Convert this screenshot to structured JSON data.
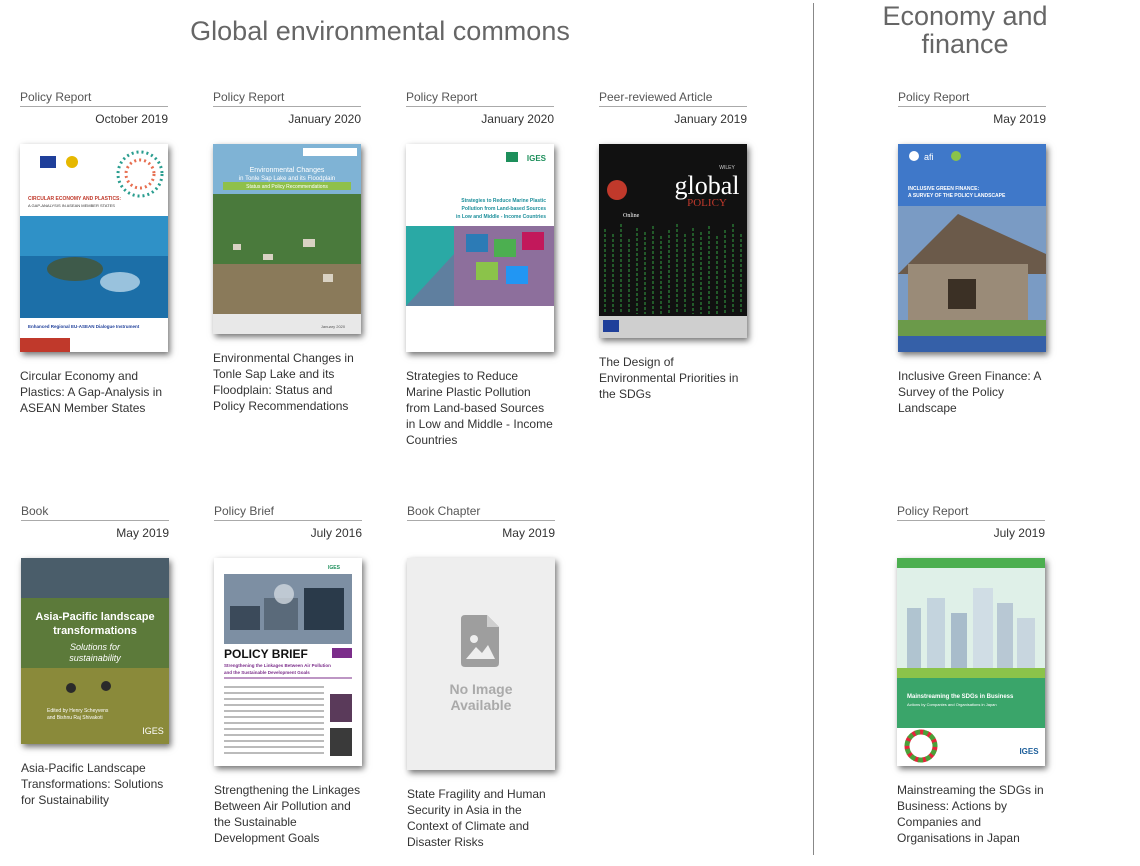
{
  "sections": {
    "global": {
      "title": "Global environmental commons"
    },
    "economy": {
      "title": "Economy and finance"
    }
  },
  "cards": [
    {
      "type": "Policy Report",
      "date": "October 2019",
      "title": "Circular Economy and Plastics: A Gap-Analysis in ASEAN Member States",
      "cover_texts": [
        "CIRCULAR ECONOMY AND PLASTICS:",
        "A GAP-ANALYSIS IN ASEAN MEMBER STATES",
        "Enhanced Regional EU-ASEAN Dialogue Instrument"
      ]
    },
    {
      "type": "Policy Report",
      "date": "January 2020",
      "title": "Environmental Changes in Tonle Sap Lake and its Floodplain: Status and Policy Recommendations",
      "cover_texts": [
        "Environmental Changes",
        "in Tonle Sap Lake and its Floodplain",
        "Status and Policy Recommendations",
        "January 2020"
      ]
    },
    {
      "type": "Policy Report",
      "date": "January 2020",
      "title": "Strategies to Reduce Marine Plastic Pollution from Land-based Sources in Low and Middle - Income Countries",
      "cover_texts": [
        "IGES",
        "Strategies to Reduce Marine Plastic",
        "Pollution from Land-based Sources",
        "in Low and Middle - Income Countries"
      ]
    },
    {
      "type": "Peer-reviewed Article",
      "date": "January 2019",
      "title": "The Design of Environmental Priorities in the SDGs",
      "cover_texts": [
        "global",
        "POLICY",
        "Online",
        "WILEY"
      ]
    },
    {
      "type": "Policy Report",
      "date": "May 2019",
      "title": "Inclusive Green Finance: A Survey of the Policy Landscape",
      "cover_texts": [
        "afi",
        "INCLUSIVE GREEN FINANCE:",
        "A SURVEY OF THE POLICY LANDSCAPE"
      ]
    },
    {
      "type": "Book",
      "date": "May 2019",
      "title": "Asia-Pacific Landscape Transformations: Solutions for Sustainability",
      "cover_texts": [
        "Asia-Pacific landscape",
        "transformations",
        "Solutions for",
        "sustainability",
        "Edited by Henry Scheyvens",
        "and Bishnu Raj Shivakoti",
        "IGES"
      ]
    },
    {
      "type": "Policy Brief",
      "date": "July 2016",
      "title": "Strengthening the Linkages Between Air Pollution and the Sustainable Development Goals",
      "cover_texts": [
        "IGES",
        "POLICY BRIEF",
        "Strengthening the Linkages Between Air Pollution",
        "and the Sustainable Development Goals"
      ]
    },
    {
      "type": "Book Chapter",
      "date": "May 2019",
      "title": "State Fragility and Human Security in Asia in the Context of Climate and Disaster Risks",
      "cover_texts": [
        "No Image",
        "Available"
      ]
    },
    {
      "type": "Policy Report",
      "date": "July 2019",
      "title": "Mainstreaming the SDGs in Business: Actions by Companies and Organisations in Japan",
      "cover_texts": [
        "Mainstreaming the SDGs in Business",
        "Actions by Companies and Organisations in Japan",
        "IGES"
      ]
    }
  ]
}
